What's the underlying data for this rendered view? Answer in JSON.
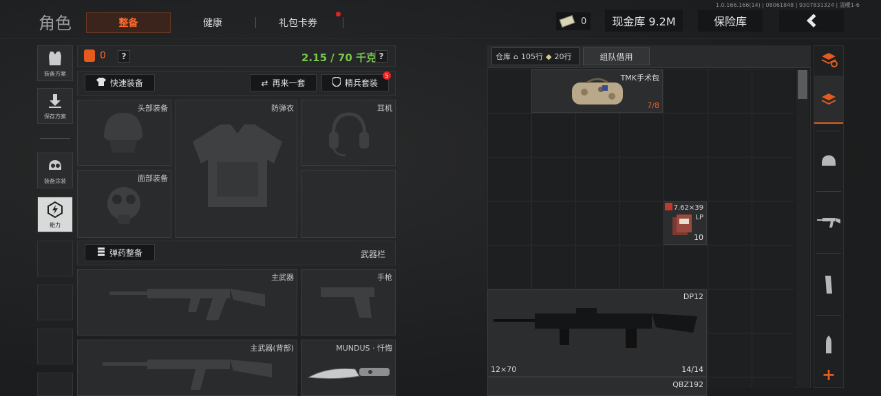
{
  "version": "1.0.166.166(14) | 08061848 | 9307831324 | 温暖1-6",
  "header": {
    "title": "角色",
    "tabs": [
      {
        "label": "整备",
        "active": true
      },
      {
        "label": "健康"
      },
      {
        "label": "礼包卡券"
      }
    ],
    "ticket_count": "0",
    "cash_label": "现金库 9.2M",
    "vault_label": "保险库",
    "accent": "#ff6a2a"
  },
  "sidebar": {
    "items": [
      {
        "label": "装备方案",
        "icon": "vest-icon"
      },
      {
        "label": "保存方案",
        "icon": "download-icon"
      },
      {
        "label": "装备涂装",
        "icon": "helmet-paint-icon"
      },
      {
        "label": "能力",
        "icon": "ability-icon"
      }
    ]
  },
  "loadout": {
    "bag_count": "0",
    "help": "?",
    "weight": "2.15 / 70 千克",
    "quick_equip": "快速装备",
    "repeat": "再来一套",
    "elite": "精兵套装",
    "elite_badge": "5",
    "slots": {
      "head": "头部装备",
      "armor": "防弹衣",
      "headset": "耳机",
      "face": "面部装备"
    },
    "ammo_equip": "弹药整备",
    "weapon_bar": "武器栏",
    "weapons": {
      "primary": "主武器",
      "pistol": "手枪",
      "primary_back": "主武器(背部)",
      "melee": "MUNDUS · 忏悔"
    }
  },
  "stash": {
    "label": "仓库",
    "rows": "105行",
    "extra_rows": "20行",
    "team_borrow": "组队借用",
    "items": [
      {
        "name": "TMK手术包",
        "count": "7/8"
      },
      {
        "name": "7.62×39",
        "sub": "LP",
        "count": "10"
      },
      {
        "name": "DP12",
        "ammo": "12×70",
        "count": "14/14"
      },
      {
        "name": "QBZ192"
      }
    ]
  },
  "rail": {
    "icons": [
      "stack-swap-icon",
      "stack-active-icon",
      "helmet-icon",
      "rifle-icon",
      "magazine-icon",
      "bullet-icon",
      "plus-icon"
    ]
  }
}
